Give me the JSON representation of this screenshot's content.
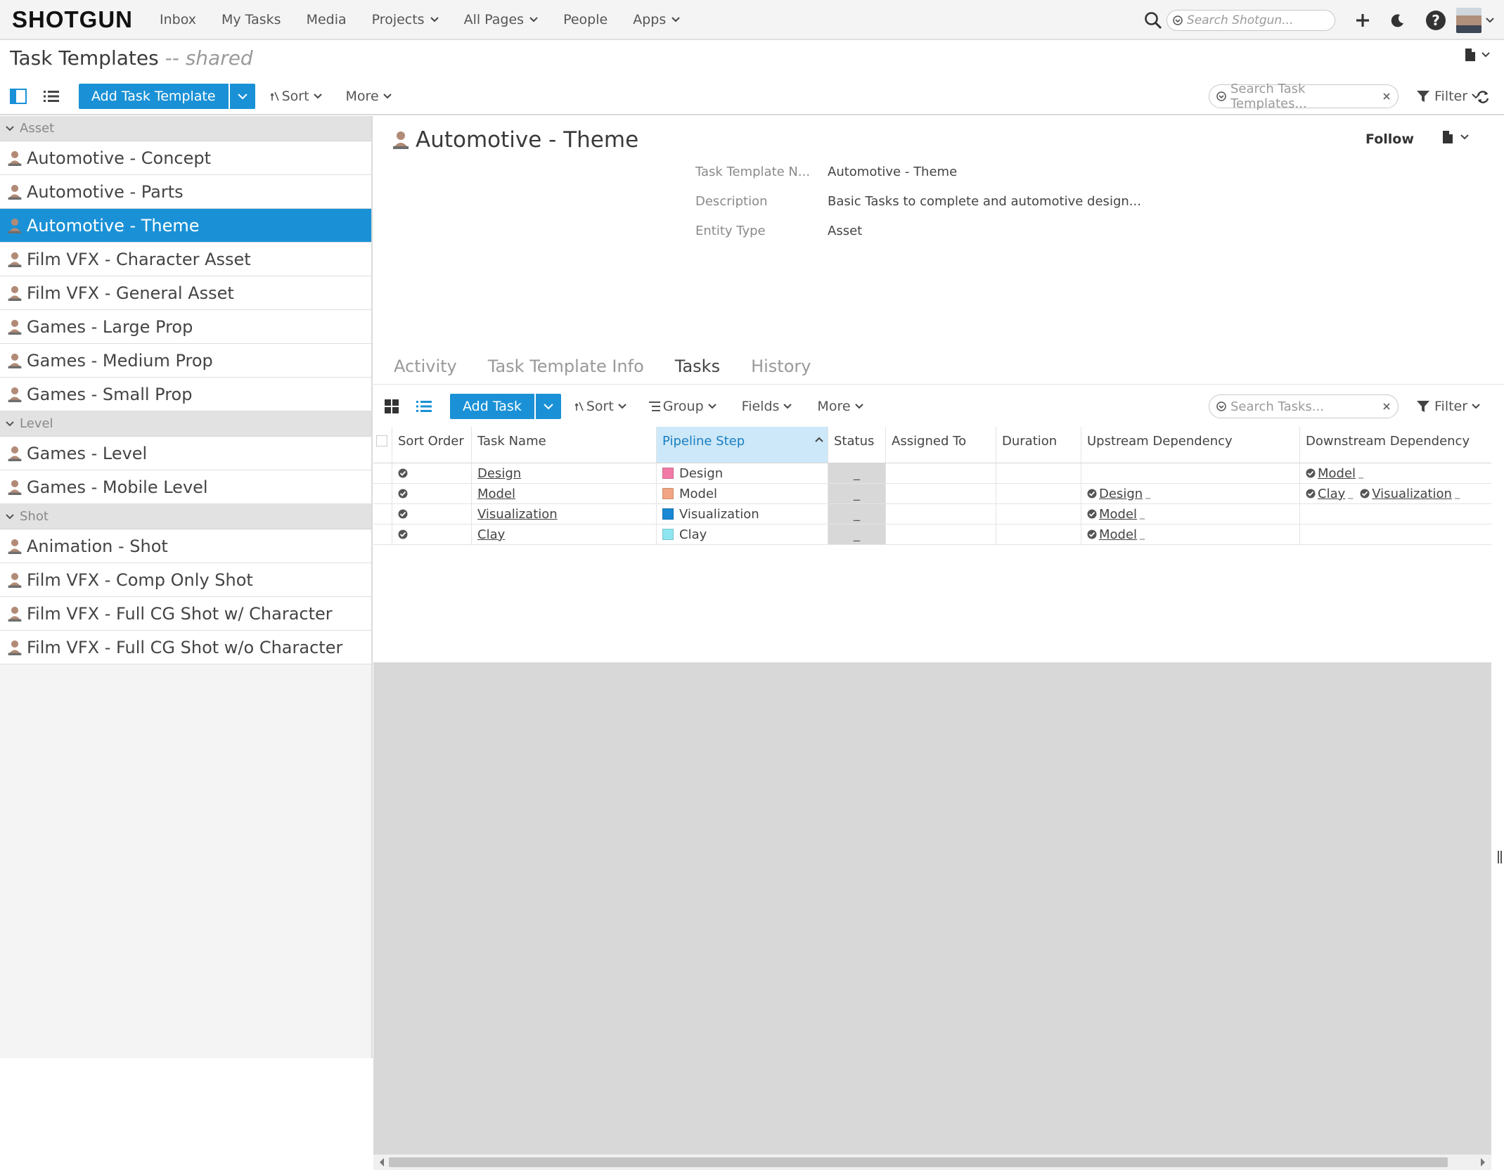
{
  "nav": {
    "logo": "SHOTGUN",
    "links": [
      "Inbox",
      "My Tasks",
      "Media",
      "Projects",
      "All Pages",
      "People",
      "Apps"
    ],
    "search_placeholder": "Search Shotgun..."
  },
  "page": {
    "title": "Task Templates",
    "subtitle": "-- shared",
    "add_button": "Add Task Template",
    "sort": "Sort",
    "more": "More",
    "search_placeholder": "Search Task Templates...",
    "filter": "Filter"
  },
  "list": {
    "groups": [
      {
        "name": "Asset",
        "items": [
          "Automotive - Concept",
          "Automotive - Parts",
          "Automotive - Theme",
          "Film VFX - Character Asset",
          "Film VFX - General Asset",
          "Games - Large Prop",
          "Games - Medium Prop",
          "Games - Small Prop"
        ]
      },
      {
        "name": "Level",
        "items": [
          "Games - Level",
          "Games - Mobile Level"
        ]
      },
      {
        "name": "Shot",
        "items": [
          "Animation - Shot",
          "Film VFX - Comp Only Shot",
          "Film VFX - Full CG Shot w/ Character",
          "Film VFX - Full CG Shot w/o Character"
        ]
      }
    ],
    "selected": "Automotive - Theme"
  },
  "detail": {
    "title": "Automotive - Theme",
    "follow": "Follow",
    "fields": [
      {
        "label": "Task Template N...",
        "value": "Automotive - Theme"
      },
      {
        "label": "Description",
        "value": "Basic Tasks to complete and automotive design..."
      },
      {
        "label": "Entity Type",
        "value": "Asset"
      }
    ],
    "tabs": [
      "Activity",
      "Task Template Info",
      "Tasks",
      "History"
    ],
    "active_tab": "Tasks"
  },
  "tasks_toolbar": {
    "add_button": "Add Task",
    "sort": "Sort",
    "group": "Group",
    "fields": "Fields",
    "more": "More",
    "search_placeholder": "Search Tasks...",
    "filter": "Filter"
  },
  "tasks_table": {
    "columns": [
      "Sort Order",
      "Task Name",
      "Pipeline Step",
      "Status",
      "Assigned To",
      "Duration",
      "Upstream Dependency",
      "Downstream Dependency"
    ],
    "sorted_column": "Pipeline Step",
    "rows": [
      {
        "name": "Design",
        "step": "Design",
        "step_color": "#f27aa7",
        "status": "_",
        "upstream": [],
        "downstream": [
          "Model"
        ]
      },
      {
        "name": "Model",
        "step": "Model",
        "step_color": "#f2a584",
        "status": "_",
        "upstream": [
          "Design"
        ],
        "downstream": [
          "Clay",
          "Visualization"
        ]
      },
      {
        "name": "Visualization",
        "step": "Visualization",
        "step_color": "#1a88d4",
        "status": "_",
        "upstream": [
          "Model"
        ],
        "downstream": []
      },
      {
        "name": "Clay",
        "step": "Clay",
        "step_color": "#8fe6f0",
        "status": "_",
        "upstream": [
          "Model"
        ],
        "downstream": []
      }
    ]
  },
  "colors": {
    "accent": "#1a91d6",
    "selected_row": "#1a91d6",
    "sorted_header": "#cde8f8"
  }
}
